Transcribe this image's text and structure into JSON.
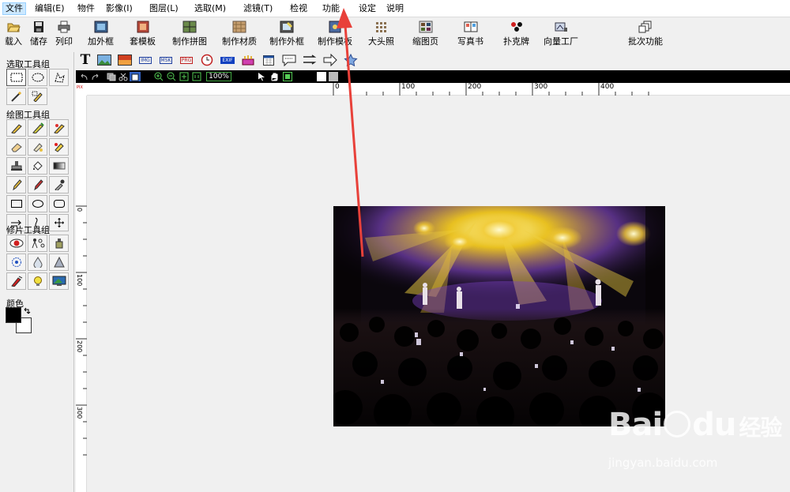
{
  "menu": [
    {
      "label": "文件"
    },
    {
      "label": "编辑(E)"
    },
    {
      "label": "物件"
    },
    {
      "label": "影像(I)"
    },
    {
      "label": "图层(L)"
    },
    {
      "label": "选取(M)"
    },
    {
      "label": "滤镜(T)"
    },
    {
      "label": "检视"
    },
    {
      "label": "功能"
    },
    {
      "label": "设定"
    },
    {
      "label": "说明"
    }
  ],
  "toolbar": [
    {
      "label": "载入",
      "icon": "open-folder-icon"
    },
    {
      "label": "储存",
      "icon": "save-disk-icon"
    },
    {
      "label": "列印",
      "icon": "printer-icon"
    },
    {
      "label": "加外框",
      "icon": "frame-icon"
    },
    {
      "label": "套模板",
      "icon": "template-icon"
    },
    {
      "label": "制作拼图",
      "icon": "puzzle-icon"
    },
    {
      "label": "制作材质",
      "icon": "texture-icon"
    },
    {
      "label": "制作外框",
      "icon": "make-frame-icon"
    },
    {
      "label": "制作模板",
      "icon": "make-template-icon"
    },
    {
      "label": "大头照",
      "icon": "headshot-icon"
    },
    {
      "label": "缩图页",
      "icon": "thumbnail-page-icon"
    },
    {
      "label": "写真书",
      "icon": "photo-book-icon"
    },
    {
      "label": "扑克牌",
      "icon": "poker-icon"
    },
    {
      "label": "向量工厂",
      "icon": "vector-factory-icon"
    },
    {
      "label": "批次功能",
      "icon": "batch-icon"
    }
  ],
  "toolbar2": {
    "text_tool": "T",
    "img_badge": "IMG",
    "msk_badge": "MSK",
    "prg_badge": "PRG",
    "exif_badge": "EXIF"
  },
  "canvasbar": {
    "zoom": "100%"
  },
  "panel": {
    "select_group": "选取工具组",
    "draw_group": "绘图工具组",
    "retouch_group": "修片工具组",
    "color_label": "颜色"
  },
  "colors": {
    "foreground": "#000000",
    "background": "#ffffff",
    "arrow": "#e8413a"
  },
  "rulers": {
    "h_ticks": [
      "0",
      "100",
      "200",
      "300",
      "400"
    ],
    "v_ticks": [
      "0",
      "100",
      "200",
      "300"
    ],
    "corner": "PIX"
  },
  "watermark": {
    "logo": "Bai",
    "logo_tail": "du",
    "logo_cn": "经验",
    "url": "jingyan.baidu.com"
  }
}
